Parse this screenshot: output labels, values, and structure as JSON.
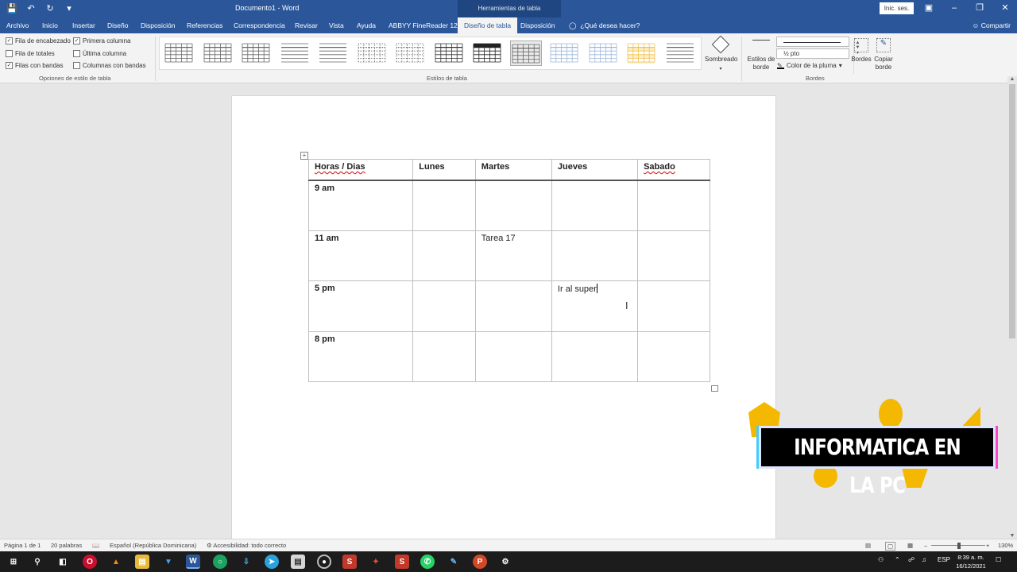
{
  "titlebar": {
    "document_title": "Documento1 - Word",
    "context_tab_group": "Herramientas de tabla",
    "signin_label": "Inic. ses."
  },
  "ribbon_tabs": [
    {
      "label": "Archivo"
    },
    {
      "label": "Inicio"
    },
    {
      "label": "Insertar"
    },
    {
      "label": "Diseño"
    },
    {
      "label": "Disposición"
    },
    {
      "label": "Referencias"
    },
    {
      "label": "Correspondencia"
    },
    {
      "label": "Revisar"
    },
    {
      "label": "Vista"
    },
    {
      "label": "Ayuda"
    },
    {
      "label": "ABBYY FineReader 12"
    },
    {
      "label": "Diseño de tabla",
      "active": true
    },
    {
      "label": "Disposición"
    }
  ],
  "tell_me": "¿Qué desea hacer?",
  "share_label": "Compartir",
  "style_options": {
    "header_row": {
      "label": "Fila de encabezado",
      "checked": true
    },
    "total_row": {
      "label": "Fila de totales",
      "checked": false
    },
    "banded_rows": {
      "label": "Filas con bandas",
      "checked": true
    },
    "first_column": {
      "label": "Primera columna",
      "checked": true
    },
    "last_column": {
      "label": "Última columna",
      "checked": false
    },
    "banded_columns": {
      "label": "Columnas con bandas",
      "checked": false
    },
    "group_label": "Opciones de estilo de tabla"
  },
  "table_styles": {
    "group_label": "Estilos de tabla",
    "thumbnails": [
      "plain",
      "light-grid",
      "light-grid",
      "light-lines",
      "light-lines",
      "light-dotted",
      "light-dotted",
      "medium-grid",
      "dark-grid",
      "light-selected",
      "blue-light",
      "blue-light",
      "gold-light",
      "plain-light"
    ],
    "selected_index": 9,
    "colors": {
      "gold": "#f2c14e",
      "blue": "#9db8d9",
      "dark": "#222222"
    }
  },
  "shading_label": "Sombreado",
  "borders": {
    "border_styles_label": "Estilos de borde",
    "line_weight": "½ pto",
    "pen_color_label": "Color de la pluma",
    "borders_label": "Bordes",
    "border_painter_label": "Copiar borde",
    "group_label": "Bordes"
  },
  "schedule": {
    "headers": [
      "Horas / Dias",
      "Lunes",
      "Martes",
      "Jueves",
      "Sabado"
    ],
    "rows": [
      {
        "hour": "9 am",
        "cells": [
          "",
          "",
          "",
          ""
        ]
      },
      {
        "hour": "11 am",
        "cells": [
          "",
          "Tarea 17",
          "",
          ""
        ]
      },
      {
        "hour": "5 pm",
        "cells": [
          "",
          "",
          "Ir al super",
          ""
        ]
      },
      {
        "hour": "8 pm",
        "cells": [
          "",
          "",
          "",
          ""
        ]
      }
    ]
  },
  "watermark": {
    "text": "INFORMATICA EN LA PC",
    "accent": "#f5b800"
  },
  "statusbar": {
    "page": "Página 1 de 1",
    "words": "20 palabras",
    "language": "Español (República Dominicana)",
    "accessibility": "Accesibilidad: todo correcto",
    "zoom": "130%"
  },
  "taskbar": {
    "language": "ESP",
    "time": "8:39 a. m.",
    "date": "16/12/2021"
  }
}
